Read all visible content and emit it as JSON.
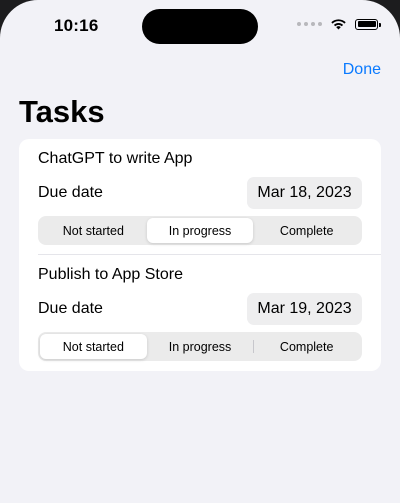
{
  "status_bar": {
    "time": "10:16",
    "icons": [
      "signal-dots-icon",
      "wifi-icon",
      "battery-icon"
    ]
  },
  "nav": {
    "done_label": "Done",
    "title": "Tasks"
  },
  "colors": {
    "accent": "#0a7aff",
    "background": "#f2f2f7",
    "card": "#ffffff",
    "segment_track": "#ebebeb"
  },
  "segment_options": [
    "Not started",
    "In progress",
    "Complete"
  ],
  "tasks": [
    {
      "name": "ChatGPT to write App",
      "due_label": "Due date",
      "due_date": "Mar 18, 2023",
      "status": "In progress"
    },
    {
      "name": "Publish to App Store",
      "due_label": "Due date",
      "due_date": "Mar 19, 2023",
      "status": "Not started"
    }
  ]
}
